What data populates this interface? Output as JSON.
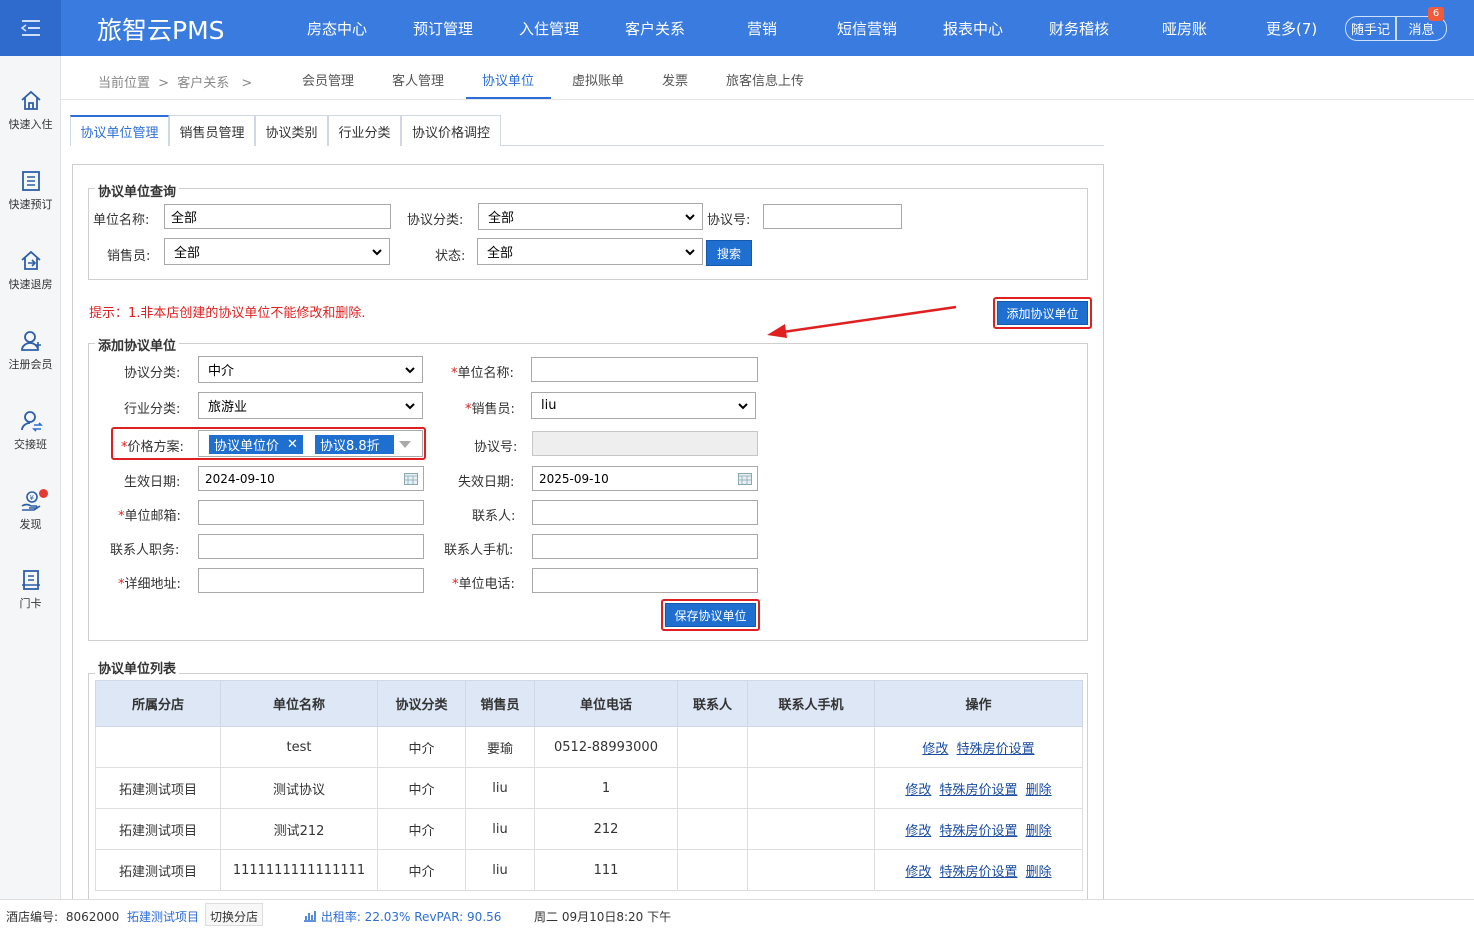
{
  "header": {
    "brand": "旅智云PMS",
    "nav": [
      "房态中心",
      "预订管理",
      "入住管理",
      "客户关系",
      "营销",
      "短信营销",
      "报表中心",
      "财务稽核",
      "哑房账",
      "更多(7)"
    ],
    "notes_label": "随手记",
    "messages_label": "消息",
    "messages_badge": "6"
  },
  "sidebar": {
    "items": [
      {
        "label": "快速入住",
        "icon": "home-icon"
      },
      {
        "label": "快速预订",
        "icon": "document-icon"
      },
      {
        "label": "快速退房",
        "icon": "checkout-icon"
      },
      {
        "label": "注册会员",
        "icon": "add-user-icon"
      },
      {
        "label": "交接班",
        "icon": "shift-handover-icon"
      },
      {
        "label": "发现",
        "icon": "discover-icon"
      },
      {
        "label": "门卡",
        "icon": "card-icon"
      }
    ]
  },
  "breadcrumb": {
    "current": "当前位置",
    "sep": ">",
    "section": "客户关系",
    "sep2": ">"
  },
  "subtabs": [
    "会员管理",
    "客人管理",
    "协议单位",
    "虚拟账单",
    "发票",
    "旅客信息上传"
  ],
  "tabs": [
    "协议单位管理",
    "销售员管理",
    "协议类别",
    "行业分类",
    "协议价格调控"
  ],
  "query": {
    "legend": "协议单位查询",
    "unit_name_label": "单位名称:",
    "unit_name_value": "全部",
    "agreement_category_label": "协议分类:",
    "agreement_category_value": "全部",
    "agreement_no_label": "协议号:",
    "agreement_no_value": "",
    "salesperson_label": "销售员:",
    "salesperson_value": "全部",
    "status_label": "状态:",
    "status_value": "全部",
    "search_label": "搜索"
  },
  "hint": "提示：1.非本店创建的协议单位不能修改和删除.",
  "add_button": "添加协议单位",
  "add_form": {
    "legend": "添加协议单位",
    "category_label": "协议分类:",
    "category_value": "中介",
    "unit_name_label": "单位名称:",
    "unit_name_value": "",
    "industry_label": "行业分类:",
    "industry_value": "旅游业",
    "salesperson_label": "销售员:",
    "salesperson_value": "liu",
    "price_plan_label": "价格方案:",
    "price_tags": [
      "协议单位价",
      "协议8.8折"
    ],
    "agreement_no_label": "协议号:",
    "agreement_no_value": "",
    "effective_label": "生效日期:",
    "effective_value": "2024-09-10",
    "expire_label": "失效日期:",
    "expire_value": "2025-09-10",
    "email_label": "单位邮箱:",
    "contact_label": "联系人:",
    "contact_title_label": "联系人职务:",
    "contact_phone_label": "联系人手机:",
    "address_label": "详细地址:",
    "unit_phone_label": "单位电话:",
    "required_mark": "*",
    "save_label": "保存协议单位"
  },
  "list": {
    "legend": "协议单位列表",
    "columns": [
      "所属分店",
      "单位名称",
      "协议分类",
      "销售员",
      "单位电话",
      "联系人",
      "联系人手机",
      "操作"
    ],
    "rows": [
      {
        "branch": "",
        "name": "test",
        "category": "中介",
        "sales": "要瑜",
        "phone": "0512-88993000",
        "contact": "",
        "mobile": "",
        "ops": [
          "修改",
          "特殊房价设置"
        ]
      },
      {
        "branch": "拓建测试项目",
        "name": "测试协议",
        "category": "中介",
        "sales": "liu",
        "phone": "1",
        "contact": "",
        "mobile": "",
        "ops": [
          "修改",
          "特殊房价设置",
          "删除"
        ]
      },
      {
        "branch": "拓建测试项目",
        "name": "测试212",
        "category": "中介",
        "sales": "liu",
        "phone": "212",
        "contact": "",
        "mobile": "",
        "ops": [
          "修改",
          "特殊房价设置",
          "删除"
        ]
      },
      {
        "branch": "拓建测试项目",
        "name": "1111111111111111",
        "category": "中介",
        "sales": "liu",
        "phone": "111",
        "contact": "",
        "mobile": "",
        "ops": [
          "修改",
          "特殊房价设置",
          "删除"
        ]
      }
    ]
  },
  "statusbar": {
    "hotel_no_label": "酒店编号:",
    "hotel_no": "8062000",
    "hotel_name": "拓建测试项目",
    "switch_label": "切换分店",
    "occupancy": "出租率: 22.03% RevPAR: 90.56",
    "datetime": "周二 09月10日8:20 下午"
  },
  "colors": {
    "primary": "#3a7be0",
    "button": "#1f6fd0",
    "highlight": "#e02020"
  }
}
